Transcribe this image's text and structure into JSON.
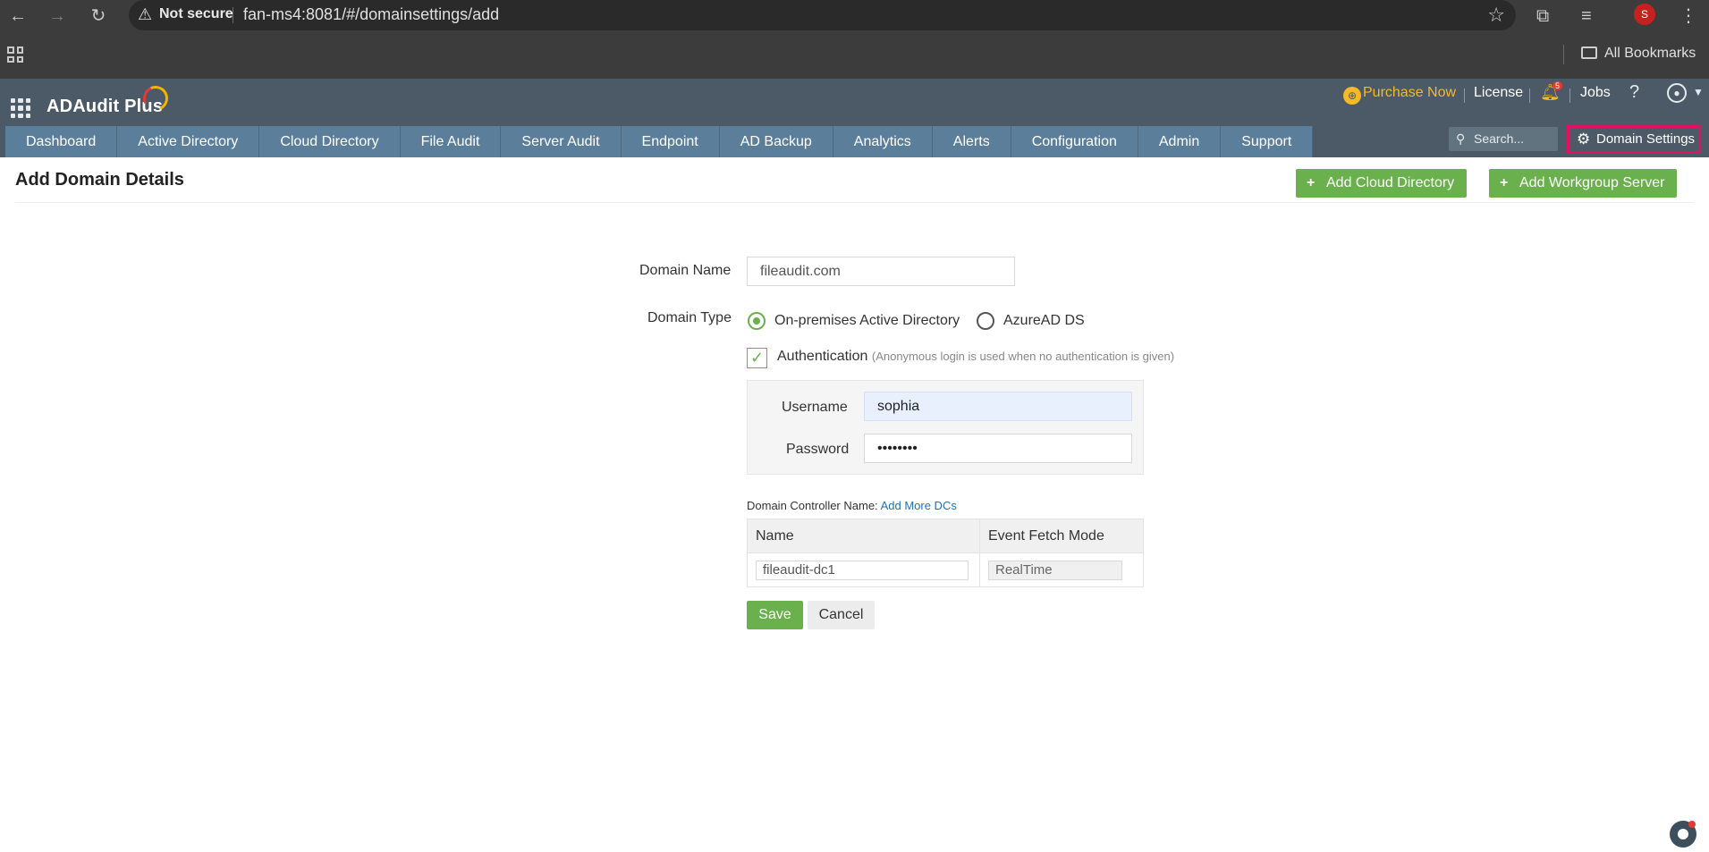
{
  "browser": {
    "secure_label": "Not secure",
    "url": "fan-ms4:8081/#/domainsettings/add",
    "profile_initial": "S",
    "all_bookmarks": "All Bookmarks"
  },
  "app": {
    "logo": "ADAudit Plus",
    "purchase_now": "Purchase Now",
    "license": "License",
    "notification_count": "5",
    "jobs": "Jobs",
    "help": "?",
    "search_placeholder": "Search...",
    "domain_settings": "Domain Settings"
  },
  "tabs": [
    {
      "label": "Dashboard"
    },
    {
      "label": "Active Directory"
    },
    {
      "label": "Cloud Directory"
    },
    {
      "label": "File Audit"
    },
    {
      "label": "Server Audit"
    },
    {
      "label": "Endpoint"
    },
    {
      "label": "AD Backup"
    },
    {
      "label": "Analytics"
    },
    {
      "label": "Alerts"
    },
    {
      "label": "Configuration"
    },
    {
      "label": "Admin"
    },
    {
      "label": "Support"
    }
  ],
  "page": {
    "title": "Add Domain Details",
    "add_cloud_directory": "Add Cloud Directory",
    "add_workgroup_server": "Add Workgroup Server"
  },
  "form": {
    "domain_name_label": "Domain Name",
    "domain_name_value": "fileaudit.com",
    "domain_type_label": "Domain Type",
    "type_onprem": "On-premises Active Directory",
    "type_azure": "AzureAD DS",
    "authentication_label": "Authentication",
    "authentication_hint": "(Anonymous login is used when no authentication is given)",
    "username_label": "Username",
    "username_value": "sophia",
    "password_label": "Password",
    "password_value": "••••••••",
    "dc_label": "Domain Controller Name:",
    "add_more_dcs": "Add More DCs",
    "dc_col_name": "Name",
    "dc_col_mode": "Event Fetch Mode",
    "dc_name_value": "fileaudit-dc1",
    "dc_mode_value": "RealTime",
    "save": "Save",
    "cancel": "Cancel"
  },
  "colors": {
    "header_bg": "#4b5a66",
    "tab_bg": "#5b7f9b",
    "accent_green": "#6ab04c",
    "highlight_border": "#e0115f",
    "purchase_color": "#f5b928"
  }
}
